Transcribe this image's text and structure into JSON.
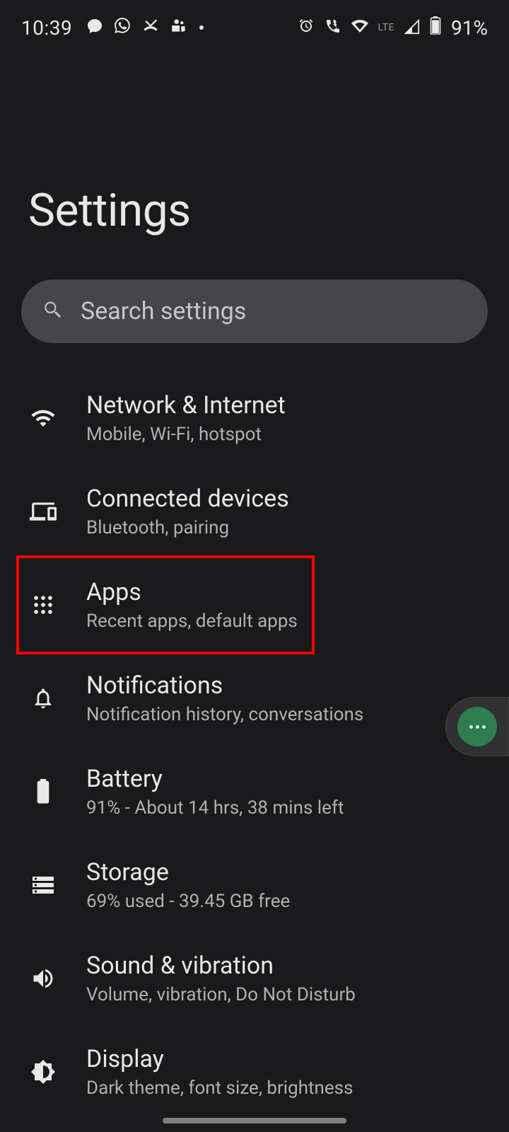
{
  "status_bar": {
    "time": "10:39",
    "battery_text": "91%"
  },
  "page": {
    "title": "Settings"
  },
  "search": {
    "placeholder": "Search settings"
  },
  "items": [
    {
      "title": "Network & Internet",
      "subtitle": "Mobile, Wi-Fi, hotspot"
    },
    {
      "title": "Connected devices",
      "subtitle": "Bluetooth, pairing"
    },
    {
      "title": "Apps",
      "subtitle": "Recent apps, default apps"
    },
    {
      "title": "Notifications",
      "subtitle": "Notification history, conversations"
    },
    {
      "title": "Battery",
      "subtitle": "91% - About 14 hrs, 38 mins left"
    },
    {
      "title": "Storage",
      "subtitle": "69% used - 39.45 GB free"
    },
    {
      "title": "Sound & vibration",
      "subtitle": "Volume, vibration, Do Not Disturb"
    },
    {
      "title": "Display",
      "subtitle": "Dark theme, font size, brightness"
    }
  ]
}
